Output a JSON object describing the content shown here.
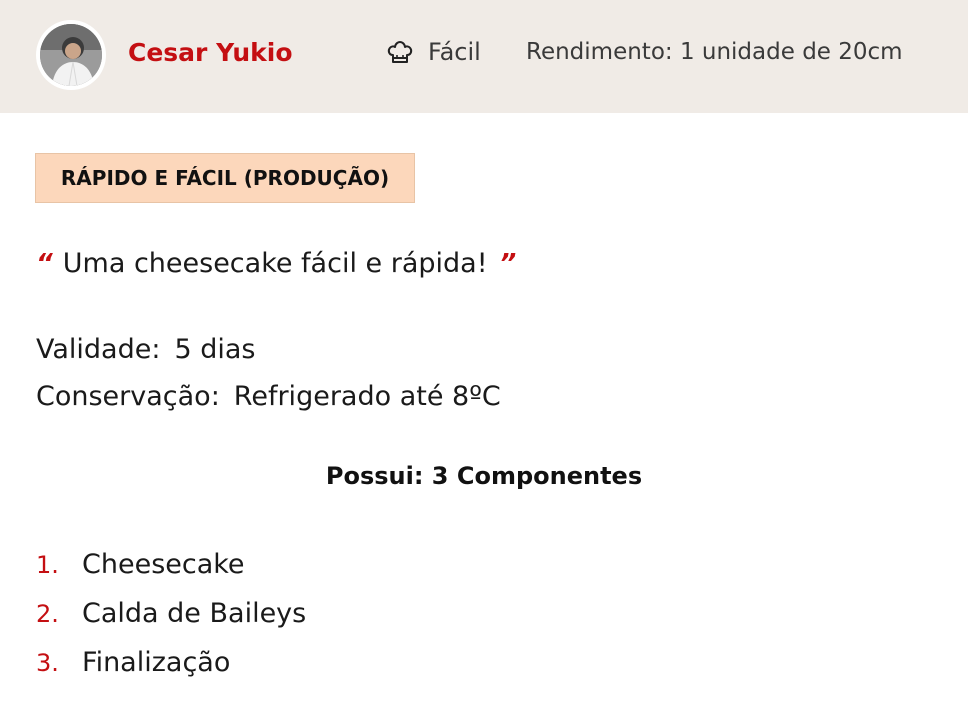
{
  "header": {
    "author_name": "Cesar Yukio",
    "difficulty_icon": "chef-hat-icon",
    "difficulty": "Fácil",
    "yield": "Rendimento: 1 unidade de 20cm"
  },
  "badge": {
    "label": "RÁPIDO E FÁCIL (PRODUÇÃO)"
  },
  "quote": {
    "open_mark": "“",
    "text": "Uma cheesecake fácil e rápida!",
    "close_mark": "”"
  },
  "info": {
    "validade_label": "Validade:",
    "validade_value": "5 dias",
    "conservacao_label": "Conservação:",
    "conservacao_value": "Refrigerado até 8ºC"
  },
  "components": {
    "title": "Possui: 3 Componentes",
    "items": [
      {
        "num": "1.",
        "label": "Cheesecake"
      },
      {
        "num": "2.",
        "label": "Calda de Baileys"
      },
      {
        "num": "3.",
        "label": "Finalização"
      }
    ]
  },
  "colors": {
    "accent": "#c40f12",
    "header_bg": "#f0ebe6",
    "badge_bg": "#fcd7bb"
  }
}
